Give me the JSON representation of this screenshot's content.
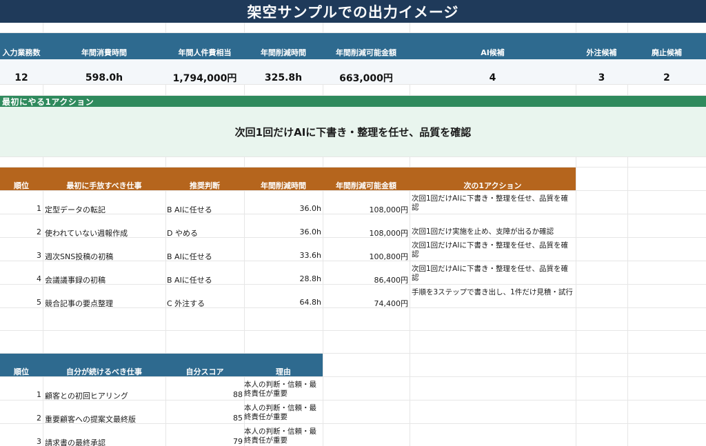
{
  "title": "架空サンプルでの出力イメージ",
  "kpi": {
    "headers": [
      "入力業務数",
      "年間消費時間",
      "年間人件費相当",
      "年間削減時間",
      "年間削減可能金額",
      "AI候補",
      "外注候補",
      "廃止候補"
    ],
    "values": [
      "12",
      "598.0h",
      "1,794,000円",
      "325.8h",
      "663,000円",
      "4",
      "3",
      "2"
    ]
  },
  "first_action": {
    "label": "最初にやる1アクション",
    "text": "次回1回だけAIに下書き・整理を任せ、品質を確認"
  },
  "task_table": {
    "headers": [
      "順位",
      "最初に手放すべき仕事",
      "推奨判断",
      "年間削減時間",
      "年間削減可能金額",
      "次の1アクション"
    ],
    "rows": [
      {
        "rank": "1",
        "task": "定型データの転記",
        "judge": "B AIに任せる",
        "hours": "36.0h",
        "amount": "108,000円",
        "next": "次回1回だけAIに下書き・整理を任せ、品質を確認"
      },
      {
        "rank": "2",
        "task": "使われていない週報作成",
        "judge": "D やめる",
        "hours": "36.0h",
        "amount": "108,000円",
        "next": "次回1回だけ実施を止め、支障が出るか確認"
      },
      {
        "rank": "3",
        "task": "週次SNS投稿の初稿",
        "judge": "B AIに任せる",
        "hours": "33.6h",
        "amount": "100,800円",
        "next": "次回1回だけAIに下書き・整理を任せ、品質を確認"
      },
      {
        "rank": "4",
        "task": "会議議事録の初稿",
        "judge": "B AIに任せる",
        "hours": "28.8h",
        "amount": "86,400円",
        "next": "次回1回だけAIに下書き・整理を任せ、品質を確認"
      },
      {
        "rank": "5",
        "task": "競合記事の要点整理",
        "judge": "C 外注する",
        "hours": "64.8h",
        "amount": "74,400円",
        "next": "手順を3ステップで書き出し、1件だけ見積・試行"
      }
    ]
  },
  "keep_table": {
    "headers": [
      "順位",
      "自分が続けるべき仕事",
      "自分スコア",
      "理由"
    ],
    "rows": [
      {
        "rank": "1",
        "task": "顧客との初回ヒアリング",
        "score": "88",
        "reason": "本人の判断・信頼・最終責任が重要"
      },
      {
        "rank": "2",
        "task": "重要顧客への提案文最終版",
        "score": "85",
        "reason": "本人の判断・信頼・最終責任が重要"
      },
      {
        "rank": "3",
        "task": "請求書の最終承認",
        "score": "79",
        "reason": "本人の判断・信頼・最終責任が重要"
      }
    ]
  },
  "colors": {
    "title_bg": "#1f3a5a",
    "kpi_header_bg": "#2e6a8f",
    "first_action_bg": "#2f8a5d",
    "first_action_body_bg": "#e9f5ee",
    "task_header_bg": "#b5651d",
    "keep_header_bg": "#2e6a8f"
  }
}
